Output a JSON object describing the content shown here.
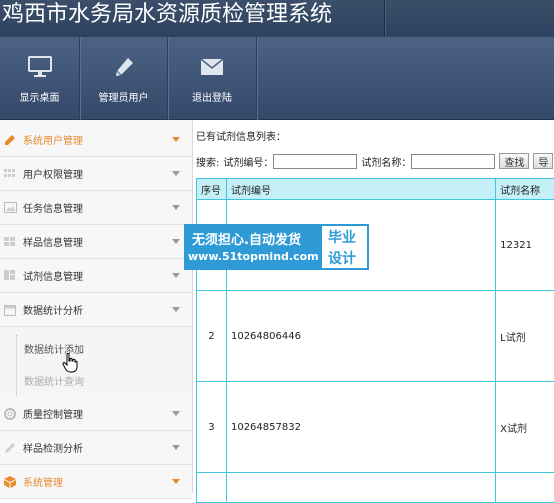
{
  "header": {
    "title": "鸡西市水务局水资源质检管理系统"
  },
  "toolbar": [
    {
      "label": "显示桌面",
      "icon": "monitor-icon"
    },
    {
      "label": "管理员用户",
      "icon": "pencil-icon"
    },
    {
      "label": "退出登陆",
      "icon": "envelope-icon"
    }
  ],
  "sidebar": {
    "items": [
      {
        "label": "系统用户管理",
        "icon": "pencil-icon",
        "active": true
      },
      {
        "label": "用户权限管理",
        "icon": "grid-icon"
      },
      {
        "label": "任务信息管理",
        "icon": "image-icon"
      },
      {
        "label": "样品信息管理",
        "icon": "grid-icon"
      },
      {
        "label": "试剂信息管理",
        "icon": "grid-icon"
      },
      {
        "label": "数据统计分析",
        "icon": "calendar-icon"
      },
      {
        "label": "质量控制管理",
        "icon": "lifebuoy-icon"
      },
      {
        "label": "样品检测分析",
        "icon": "pencil-icon"
      },
      {
        "label": "系统管理",
        "icon": "box-icon",
        "active": true
      }
    ],
    "subitems": [
      {
        "label": "数据统计添加"
      },
      {
        "label": "数据统计查询"
      }
    ]
  },
  "main": {
    "list_title": "已有试剂信息列表：",
    "search": {
      "prefix": "搜索:",
      "field1_label": "试剂编号：",
      "field1_value": "",
      "field2_label": "试剂名称：",
      "field2_value": "",
      "search_button": "查找",
      "export_button": "导"
    },
    "table": {
      "headers": [
        "序号",
        "试剂编号",
        "试剂名称"
      ],
      "rows": [
        {
          "no": "",
          "code": "",
          "name": "12321"
        },
        {
          "no": "2",
          "code": "10264806446",
          "name": "L试剂"
        },
        {
          "no": "3",
          "code": "10264857832",
          "name": "X试剂"
        }
      ]
    }
  },
  "watermark": {
    "line1": "无须担心.自动发货",
    "line2": "www.51topmind.com",
    "right1": "毕业",
    "right2": "设计"
  },
  "colors": {
    "accent": "#e88a2e",
    "header": "#35496a",
    "table_border": "#3fc6dc",
    "table_head": "#c6f0f7",
    "watermark": "#2e9bd6"
  }
}
